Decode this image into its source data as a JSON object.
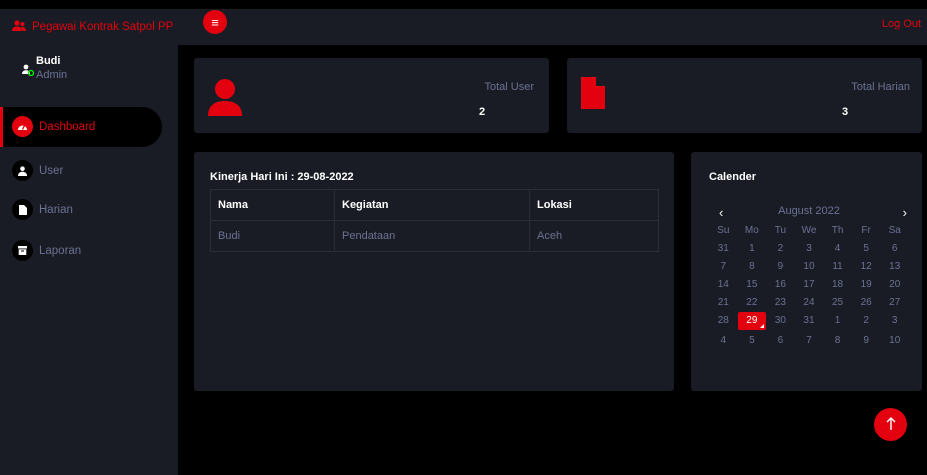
{
  "brand": {
    "title": "Pegawai Kontrak Satpol PP",
    "icon": "users-icon"
  },
  "header": {
    "menu_icon": "menu-icon",
    "logout_label": "Log Out"
  },
  "user": {
    "name": "Budi",
    "role": "Admin"
  },
  "nav": [
    {
      "label": "Dashboard",
      "icon": "dashboard-icon",
      "active": true
    },
    {
      "label": "User",
      "icon": "user-icon",
      "active": false
    },
    {
      "label": "Harian",
      "icon": "file-icon",
      "active": false
    },
    {
      "label": "Laporan",
      "icon": "archive-icon",
      "active": false
    }
  ],
  "stats": [
    {
      "label": "Total User",
      "value": "2",
      "icon": "user-icon"
    },
    {
      "label": "Total Harian",
      "value": "3",
      "icon": "file-icon"
    }
  ],
  "kinerja": {
    "title": "Kinerja Hari Ini : 29-08-2022",
    "headers": [
      "Nama",
      "Kegiatan",
      "Lokasi"
    ],
    "rows": [
      [
        "Budi",
        "Pendataan",
        "Aceh"
      ]
    ]
  },
  "calendar": {
    "title": "Calender",
    "month": "August 2022",
    "prev": "‹",
    "next": "›",
    "weekdays": [
      "Su",
      "Mo",
      "Tu",
      "We",
      "Th",
      "Fr",
      "Sa"
    ],
    "days": [
      "31",
      "1",
      "2",
      "3",
      "4",
      "5",
      "6",
      "7",
      "8",
      "9",
      "10",
      "11",
      "12",
      "13",
      "14",
      "15",
      "16",
      "17",
      "18",
      "19",
      "20",
      "21",
      "22",
      "23",
      "24",
      "25",
      "26",
      "27",
      "28",
      "29",
      "30",
      "31",
      "1",
      "2",
      "3",
      "4",
      "5",
      "6",
      "7",
      "8",
      "9",
      "10"
    ],
    "selected": "29"
  },
  "colors": {
    "accent": "#e3000f",
    "panel": "#191c24",
    "muted": "#6c7293"
  },
  "scroll_top_icon": "arrow-up-icon"
}
